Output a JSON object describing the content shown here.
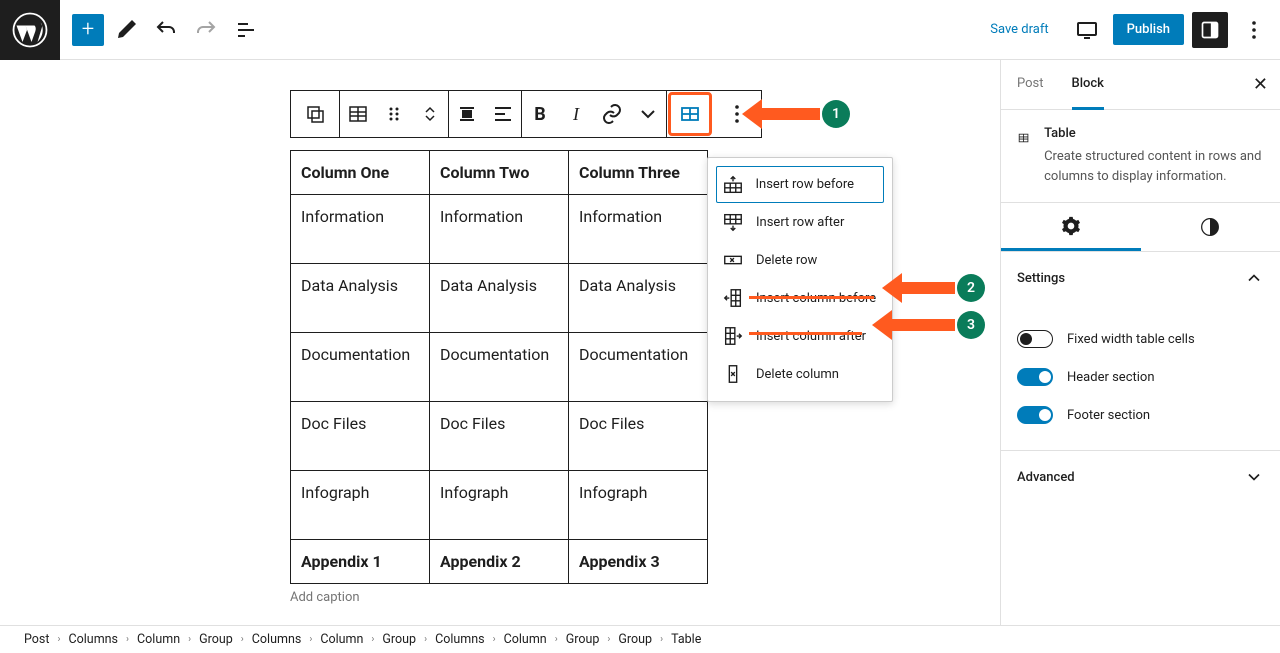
{
  "topbar": {
    "save_draft": "Save draft",
    "publish": "Publish"
  },
  "dropdown": {
    "insert_row_before": "Insert row before",
    "insert_row_after": "Insert row after",
    "delete_row": "Delete row",
    "insert_col_before": "Insert column before",
    "insert_col_after": "Insert column after",
    "delete_col": "Delete column"
  },
  "table": {
    "headers": [
      "Column One",
      "Column Two",
      "Column Three"
    ],
    "rows": [
      [
        "Information",
        "Information",
        "Information"
      ],
      [
        "Data Analysis",
        "Data Analysis",
        "Data Analysis"
      ],
      [
        "Documentation",
        "Documentation",
        "Documentation"
      ],
      [
        "Doc Files",
        "Doc Files",
        "Doc Files"
      ],
      [
        "Infograph",
        "Infograph",
        "Infograph"
      ]
    ],
    "footer": [
      "Appendix 1",
      "Appendix 2",
      "Appendix 3"
    ],
    "caption": "Add caption"
  },
  "sidebar": {
    "tabs": {
      "post": "Post",
      "block": "Block"
    },
    "block": {
      "title": "Table",
      "desc": "Create structured content in rows and columns to display information."
    },
    "settings_label": "Settings",
    "fixed_width": "Fixed width table cells",
    "header_section": "Header section",
    "footer_section": "Footer section",
    "advanced": "Advanced"
  },
  "breadcrumb": [
    "Post",
    "Columns",
    "Column",
    "Group",
    "Columns",
    "Column",
    "Group",
    "Columns",
    "Column",
    "Group",
    "Group",
    "Table"
  ],
  "annotations": {
    "1": "1",
    "2": "2",
    "3": "3"
  }
}
